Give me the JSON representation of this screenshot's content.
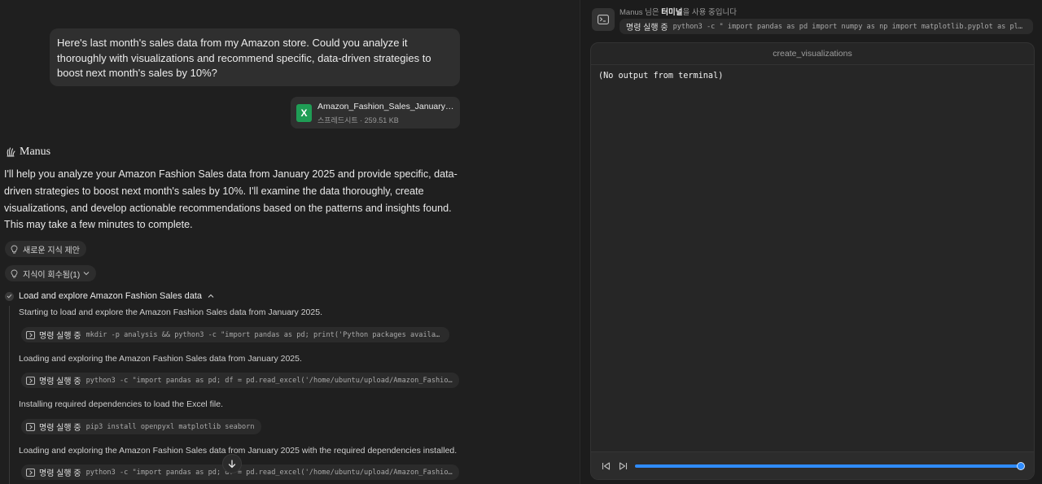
{
  "chat": {
    "user_message": "Here's last month's sales data from my Amazon store. Could you analyze it thoroughly with visualizations and recommend specific, data-driven strategies to boost next month's sales by 10%?",
    "attachment": {
      "icon_letter": "X",
      "name": "Amazon_Fashion_Sales_January_2...",
      "meta": "스프레드시트 · 259.51 KB"
    },
    "agent_name": "Manus",
    "agent_message": "I'll help you analyze your Amazon Fashion Sales data from January 2025 and provide specific, data-driven strategies to boost next month's sales by 10%. I'll examine the data thoroughly, create visualizations, and develop actionable recommendations based on the patterns and insights found. This may take a few minutes to complete.",
    "knowledge_suggest": "새로운 지식 제안",
    "knowledge_recalled": "지식이 회수됨(1)",
    "task_title": "Load and explore Amazon Fashion Sales data",
    "steps": [
      {
        "text": "Starting to load and explore the Amazon Fashion Sales data from January 2025.",
        "cmd_label": "명령 실행 중",
        "cmd": "mkdir -p analysis && python3 -c \"import pandas as pd; print('Python packages available')\""
      },
      {
        "text": "Loading and exploring the Amazon Fashion Sales data from January 2025.",
        "cmd_label": "명령 실행 중",
        "cmd": "python3 -c \"import pandas as pd; df = pd.read_excel('/home/ubuntu/upload/Amazon_Fashion_Sa..."
      },
      {
        "text": "Installing required dependencies to load the Excel file.",
        "cmd_label": "명령 실행 중",
        "cmd": "pip3 install openpyxl matplotlib seaborn"
      },
      {
        "text": "Loading and exploring the Amazon Fashion Sales data from January 2025 with the required dependencies installed.",
        "cmd_label": "명령 실행 중",
        "cmd": "python3 -c \"import pandas as pd; df = pd.read_excel('/home/ubuntu/upload/Amazon_Fashion_Sa..."
      }
    ]
  },
  "terminal": {
    "status_prefix": "Manus 님은 ",
    "status_tool": "터미널",
    "status_suffix": "을 사용 중입니다",
    "cmd_label": "명령 실행 중",
    "cmd": "python3 -c \" import pandas as pd import numpy as np import matplotlib.pyplot as plt imp...",
    "window_title": "create_visualizations",
    "output": "(No output from terminal)",
    "progress": 1.0
  },
  "colors": {
    "accent": "#2f8cff",
    "excel": "#1f9d55"
  }
}
